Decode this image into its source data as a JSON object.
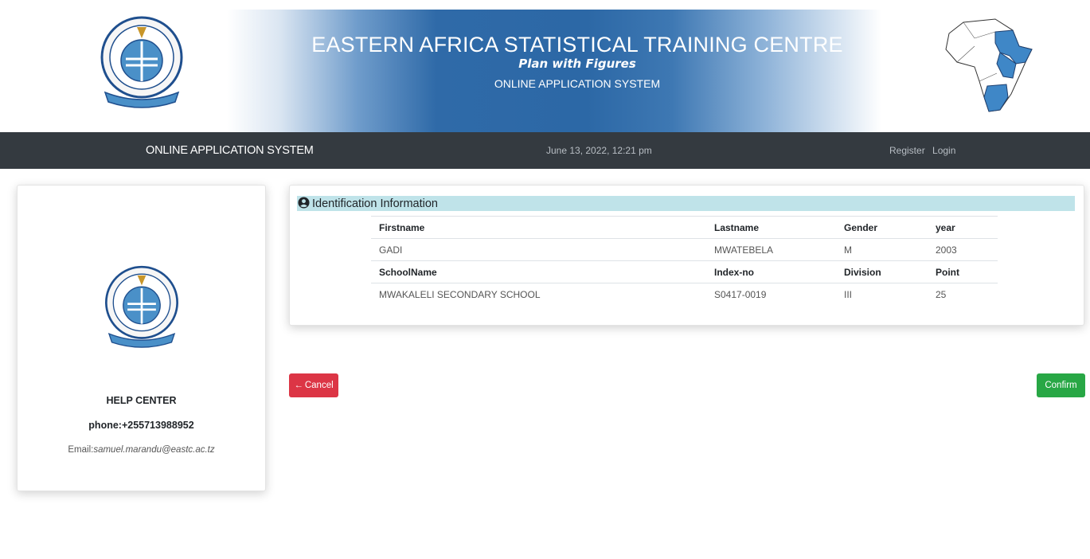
{
  "banner": {
    "title": "EASTERN AFRICA STATISTICAL TRAINING CENTRE",
    "motto": "Plan with Figures",
    "system": "ONLINE APPLICATION SYSTEM"
  },
  "navbar": {
    "brand": "ONLINE APPLICATION SYSTEM",
    "date": "June 13, 2022, 12:21 pm",
    "register": "Register",
    "login": "Login"
  },
  "help": {
    "title": "HELP CENTER",
    "phone": "phone:+255713988952",
    "email_label": "Email:",
    "email": "samuel.marandu@eastc.ac.tz"
  },
  "identification": {
    "heading": "Identification Information",
    "headers1": [
      "Firstname",
      "Lastname",
      "Gender",
      "year"
    ],
    "row1": [
      "GADI",
      "MWATEBELA",
      "M",
      "2003"
    ],
    "headers2": [
      "SchoolName",
      "Index-no",
      "Division",
      "Point"
    ],
    "row2": [
      "MWAKALELI SECONDARY SCHOOL",
      "S0417-0019",
      "III",
      "25"
    ]
  },
  "actions": {
    "cancel": "Cancel",
    "confirm": "Confirm"
  },
  "colors": {
    "navbar": "#343a40",
    "header_bg": "#bfe3e9",
    "cancel": "#dc3545",
    "confirm": "#28a745",
    "banner_blue": "#2f6aa8"
  }
}
